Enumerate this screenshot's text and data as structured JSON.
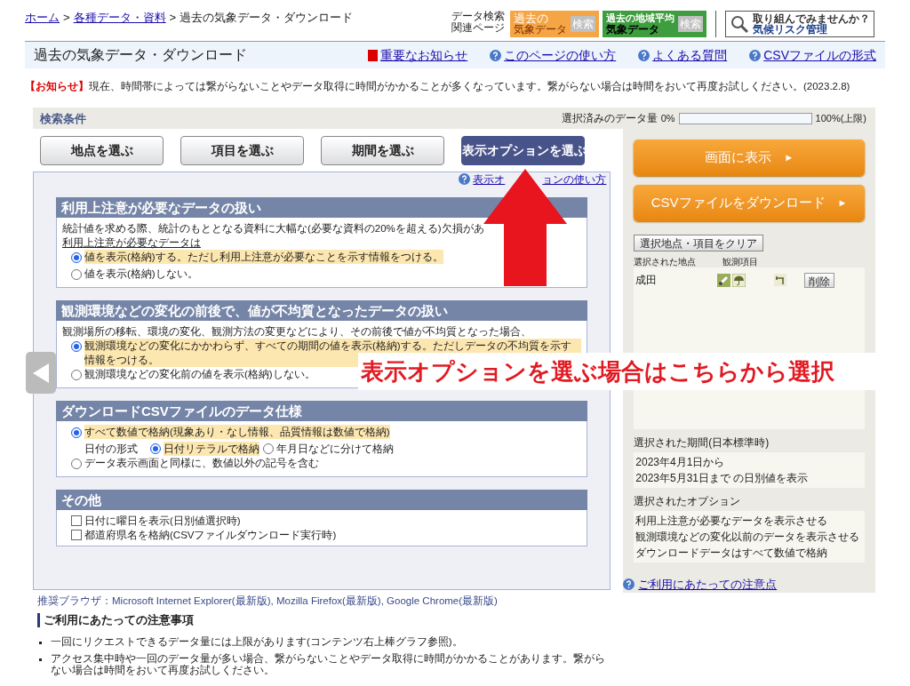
{
  "breadcrumb": {
    "separator": ">",
    "items": [
      {
        "label": "ホーム",
        "link": true
      },
      {
        "label": "各種データ・資料",
        "link": true
      },
      {
        "label": "過去の気象データ・ダウンロード",
        "link": false
      }
    ]
  },
  "related": {
    "label_lines": [
      "データ検索",
      "関連ページ"
    ],
    "banners": [
      {
        "kind": "past",
        "top": "過去の",
        "bottom": "気象データ",
        "tag": "検索"
      },
      {
        "kind": "regional",
        "top": "過去の地域平均",
        "bottom": "気象データ",
        "tag": "検索"
      },
      {
        "kind": "risk",
        "top": "取り組んでみませんか？",
        "bottom": "気候リスク管理"
      }
    ]
  },
  "page_title": "過去の気象データ・ダウンロード",
  "header_links": [
    {
      "kind": "notice",
      "label": "重要なお知らせ"
    },
    {
      "kind": "help",
      "label": "このページの使い方"
    },
    {
      "kind": "help",
      "label": "よくある質問"
    },
    {
      "kind": "help",
      "label": "CSVファイルの形式"
    }
  ],
  "notice": {
    "tag": "【お知らせ】",
    "text": "現在、時間帯によっては繋がらないことやデータ取得に時間がかかることが多くなっています。繋がらない場合は時間をおいて再度お試しください。(2023.2.8)"
  },
  "search": {
    "title": "検索条件",
    "quota": {
      "label": "選択済みのデータ量",
      "min": "0%",
      "max": "100%(上限)",
      "level": 0
    }
  },
  "tabs": [
    {
      "label": "地点を選ぶ",
      "selected": false
    },
    {
      "label": "項目を選ぶ",
      "selected": false
    },
    {
      "label": "期間を選ぶ",
      "selected": false
    },
    {
      "label": "表示オプションを選ぶ",
      "selected": true
    }
  ],
  "help_link_parts": [
    "表示オ",
    "ョンの使い方"
  ],
  "sections": [
    {
      "title": "利用上注意が必要なデータの扱い",
      "intro": "統計値を求める際、統計のもととなる資料に大幅な(必要な資料の20%を超える)欠損があ",
      "subhead": "利用上注意が必要なデータは",
      "options": [
        {
          "kind": "radio",
          "label": "値を表示(格納)する。ただし利用上注意が必要なことを示す情報をつける。",
          "selected": true
        },
        {
          "kind": "radio",
          "label": "値を表示(格納)しない。",
          "selected": false
        }
      ]
    },
    {
      "title": "観測環境などの変化の前後で、値が不均質となったデータの扱い",
      "intro": "観測場所の移転、環境の変化、観測方法の変更などにより、その前後で値が不均質となった場合、",
      "options": [
        {
          "kind": "radio",
          "label": "観測環境などの変化にかかわらず、すべての期間の値を表示(格納)する。ただしデータの不均質を示す情報をつける。",
          "selected": true
        },
        {
          "kind": "radio",
          "label": "観測環境などの変化前の値を表示(格納)しない。",
          "selected": false
        }
      ]
    },
    {
      "title": "ダウンロードCSVファイルのデータ仕様",
      "options": [
        {
          "kind": "radio",
          "label": "すべて数値で格納(現象あり・なし情報、品質情報は数値で格納)",
          "selected": true
        },
        {
          "kind": "subgroup",
          "label": "日付の形式",
          "options": [
            {
              "label": "日付リテラルで格納",
              "selected": true
            },
            {
              "label": "年月日などに分けて格納",
              "selected": false
            }
          ]
        },
        {
          "kind": "radio",
          "label": "データ表示画面と同様に、数値以外の記号を含む",
          "selected": false
        }
      ]
    },
    {
      "title": "その他",
      "options": [
        {
          "kind": "checkbox",
          "label": "日付に曜日を表示(日別値選択時)",
          "checked": false
        },
        {
          "kind": "checkbox",
          "label": "都道府県名を格納(CSVファイルダウンロード実行時)",
          "checked": false
        }
      ]
    }
  ],
  "browsers": "推奨ブラウザ：Microsoft Internet Explorer(最新版), Mozilla Firefox(最新版), Google Chrome(最新版)",
  "notes": {
    "title": "ご利用にあたっての注意事項",
    "items": [
      "一回にリクエストできるデータ量には上限があります(コンテンツ右上棒グラフ参照)。",
      "アクセス集中時や一回のデータ量が多い場合、繋がらないことやデータ取得に時間がかかることがあります。繋がらない場合は時間をおいて再度お試しください。"
    ]
  },
  "actions": [
    {
      "label": "画面に表示",
      "arrow": "►"
    },
    {
      "label": "CSVファイルをダウンロード",
      "arrow": "►"
    }
  ],
  "clear_button": "選択地点・項目をクリア",
  "station_headers": [
    "選択された地点",
    "観測項目"
  ],
  "stations": [
    {
      "name": "成田",
      "delete": "削除"
    }
  ],
  "period": {
    "label": "選択された期間(日本標準時)",
    "lines": [
      "2023年4月1日から",
      "2023年5月31日まで の日別値を表示"
    ]
  },
  "selected_options": {
    "label": "選択されたオプション",
    "lines": [
      "利用上注意が必要なデータを表示させる",
      "観測環境などの変化以前のデータを表示させる",
      "ダウンロードデータはすべて数値で格納"
    ]
  },
  "footer_link": "ご利用にあたっての注意点",
  "overlay": {
    "caption": "表示オプションを選ぶ場合はこちらから選択"
  }
}
